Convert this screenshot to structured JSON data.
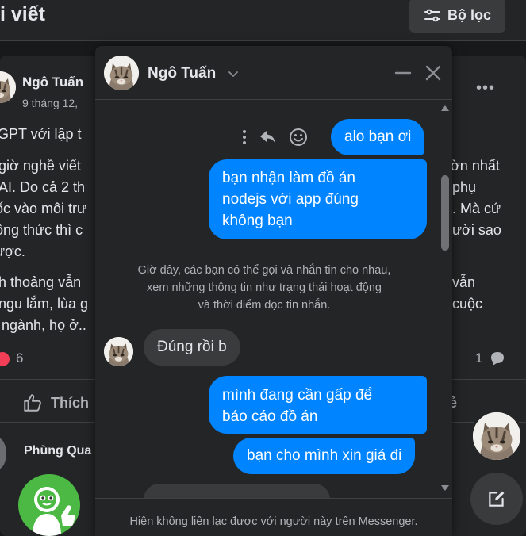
{
  "page": {
    "heading": "i viết",
    "filter_label": "Bộ lọc"
  },
  "post": {
    "author": "Ngô Tuấn",
    "date": "9 tháng 12,",
    "lines_left": [
      "tGPT với lập t",
      "giờ nghề viết",
      "AI. Do cả 2 th",
      "ốc vào môi trư",
      "ông thức thì c",
      "ược.",
      "h thoảng vẫn",
      "ngu lắm, lùa g",
      "ngành, họ ở.."
    ],
    "lines_right": [
      "ờn nhất",
      "phụ",
      ". Mà cứ",
      "ười sao",
      "vẫn",
      "cuộc"
    ],
    "reaction_count": "6",
    "comment_count": "1",
    "like_label": "Thích",
    "share_fragment": "ẻ",
    "commenter": "Phùng Qua"
  },
  "chat": {
    "contact_name": "Ngô Tuấn",
    "messages": [
      {
        "dir": "out",
        "text": "alo bạn ơi"
      },
      {
        "dir": "out",
        "lines": [
          "bạn nhận làm đồ án",
          "nodejs với app đúng",
          "không bạn"
        ]
      },
      {
        "dir": "in",
        "text": "Đúng rồi b"
      },
      {
        "dir": "out",
        "lines": [
          "mình đang cần gấp để",
          "báo cáo đồ án"
        ]
      },
      {
        "dir": "out",
        "text": "bạn cho mình xin giá đi"
      }
    ],
    "system_notice": [
      "Giờ đây, các bạn có thể gọi và nhắn tin cho nhau,",
      "xem những thông tin như trạng thái hoạt động",
      "và thời điểm đọc tin nhắn."
    ],
    "footer_notice": "Hiện không liên lạc được với người này trên Messenger."
  },
  "colors": {
    "background": "#18191a",
    "surface": "#242526",
    "outgoing_bubble": "#0084ff",
    "incoming_bubble": "#3a3b3c",
    "text_primary": "#e4e6eb",
    "text_secondary": "#b0b3b8",
    "reaction_heart": "#f33e58",
    "logo_green": "#4cb944"
  },
  "icons": [
    "sliders-icon",
    "cat-avatar-icon",
    "more-dots-icon",
    "like-thumb-icon",
    "chevron-down-icon",
    "minimize-icon",
    "close-icon",
    "more-vertical-icon",
    "reply-icon",
    "emoji-icon",
    "scroll-up-arrow-icon",
    "scroll-down-arrow-icon",
    "compose-icon",
    "heart-icon",
    "comment-icon"
  ]
}
